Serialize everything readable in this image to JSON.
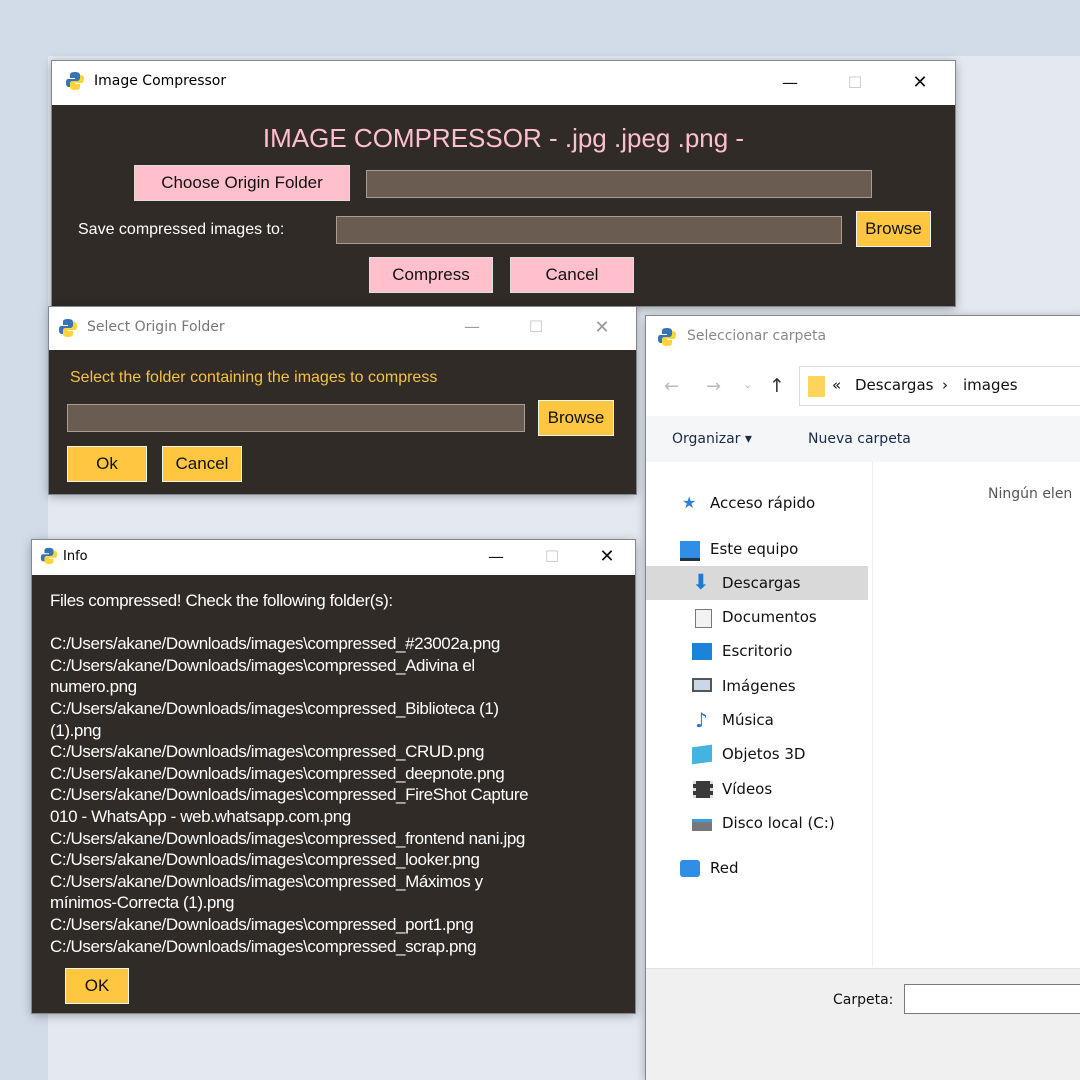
{
  "main_window": {
    "title": "Image Compressor",
    "heading": "IMAGE COMPRESSOR - .jpg .jpeg .png -",
    "choose_origin_label": "Choose Origin Folder",
    "origin_value": "",
    "save_to_label": "Save compressed images to:",
    "save_to_value": "",
    "browse_label": "Browse",
    "compress_label": "Compress",
    "cancel_label": "Cancel",
    "controls": {
      "minimize": "—",
      "maximize": "☐",
      "close": "✕"
    }
  },
  "origin_dialog": {
    "title": "Select Origin Folder",
    "prompt": "Select the folder containing the images to compress",
    "path_value": "",
    "browse_label": "Browse",
    "ok_label": "Ok",
    "cancel_label": "Cancel"
  },
  "info_dialog": {
    "title": "Info",
    "message_lines": [
      "Files compressed! Check the following folder(s):",
      "",
      "C:/Users/akane/Downloads/images\\compressed_#23002a.png",
      "C:/Users/akane/Downloads/images\\compressed_Adivina el",
      "numero.png",
      "C:/Users/akane/Downloads/images\\compressed_Biblioteca (1)",
      "(1).png",
      "C:/Users/akane/Downloads/images\\compressed_CRUD.png",
      "C:/Users/akane/Downloads/images\\compressed_deepnote.png",
      "C:/Users/akane/Downloads/images\\compressed_FireShot Capture",
      "010 - WhatsApp - web.whatsapp.com.png",
      "C:/Users/akane/Downloads/images\\compressed_frontend nani.jpg",
      "C:/Users/akane/Downloads/images\\compressed_looker.png",
      "C:/Users/akane/Downloads/images\\compressed_Máximos y",
      "mínimos-Correcta (1).png",
      "C:/Users/akane/Downloads/images\\compressed_port1.png",
      "C:/Users/akane/Downloads/images\\compressed_scrap.png"
    ],
    "ok_label": "OK"
  },
  "folder_dialog": {
    "title": "Seleccionar carpeta",
    "breadcrumb_prefix": "«",
    "breadcrumb": [
      "Descargas",
      "images"
    ],
    "breadcrumb_separator": "›",
    "organize_label": "Organizar ▾",
    "new_folder_label": "Nueva carpeta",
    "empty_message": "Ningún elen",
    "sidebar": {
      "quick_access": "Acceso rápido",
      "this_pc": "Este equipo",
      "items": [
        "Descargas",
        "Documentos",
        "Escritorio",
        "Imágenes",
        "Música",
        "Objetos 3D",
        "Vídeos",
        "Disco local (C:)"
      ],
      "network": "Red"
    },
    "folder_label": "Carpeta:",
    "folder_value": ""
  },
  "colors": {
    "dark_bg": "#302b27",
    "pink_button": "#ffc0cb",
    "yellow_button": "#ffc740",
    "entry_bg": "#6b5c52",
    "heading_pink": "#ffc0cb",
    "prompt_yellow": "#f5c243"
  }
}
